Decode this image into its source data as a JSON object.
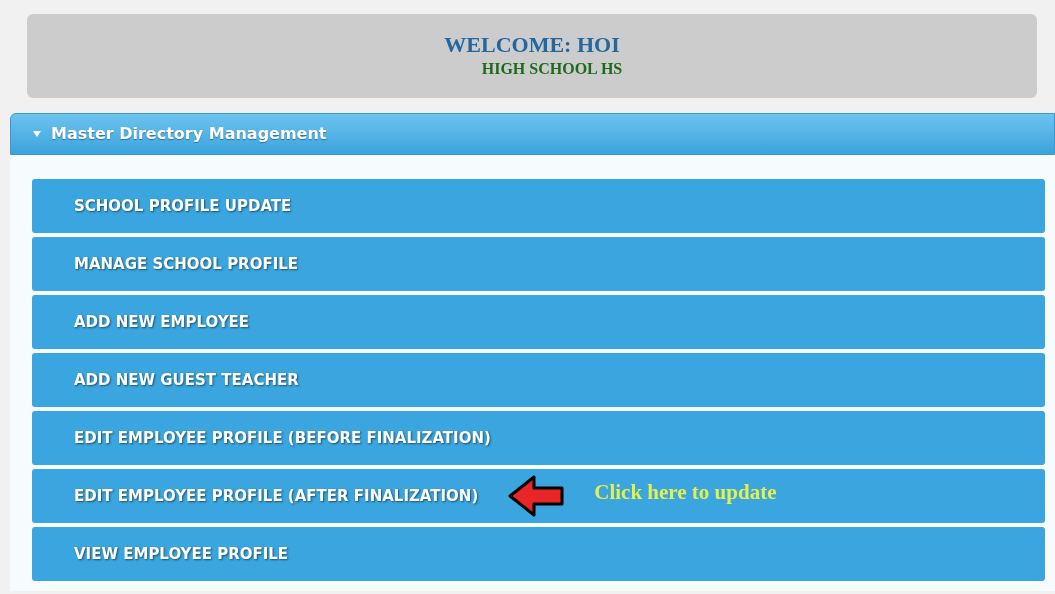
{
  "welcome": {
    "title": "WELCOME: HOI",
    "school": "HIGH SCHOOL HS"
  },
  "panel": {
    "title": "Master Directory Management",
    "expanded": true,
    "items": [
      {
        "label": "SCHOOL PROFILE UPDATE"
      },
      {
        "label": "MANAGE SCHOOL PROFILE"
      },
      {
        "label": "ADD NEW EMPLOYEE"
      },
      {
        "label": "ADD NEW GUEST TEACHER"
      },
      {
        "label": "EDIT EMPLOYEE PROFILE (BEFORE FINALIZATION)"
      },
      {
        "label": "EDIT EMPLOYEE PROFILE (AFTER FINALIZATION)",
        "callout": "Click here to update"
      },
      {
        "label": "VIEW EMPLOYEE PROFILE"
      }
    ]
  }
}
